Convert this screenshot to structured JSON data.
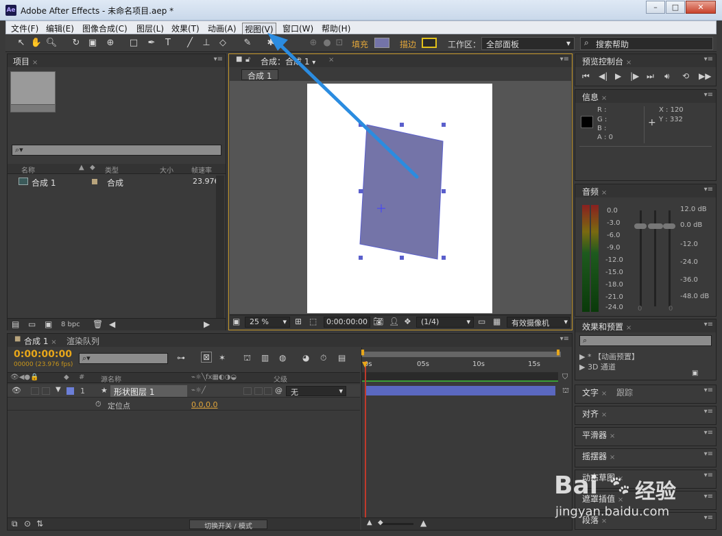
{
  "window": {
    "title": "Adobe After Effects - 未命名项目.aep *",
    "logo": "Ae",
    "min": "–",
    "max": "□",
    "close": "✕"
  },
  "menu": [
    "文件(F)",
    "编辑(E)",
    "图像合成(C)",
    "图层(L)",
    "效果(T)",
    "动画(A)",
    "视图(V)",
    "窗口(W)",
    "帮助(H)"
  ],
  "toolbar": {
    "fill_label": "填充",
    "stroke_label": "描边",
    "workspace_label": "工作区：",
    "workspace_value": "全部面板",
    "search_help": "搜索帮助",
    "fill_color": "#7474a8",
    "stroke_color": "#e3c21a"
  },
  "project": {
    "tab": "项目",
    "search_placeholder": "",
    "columns": [
      "名称",
      "类型",
      "大小",
      "帧速率"
    ],
    "rows": [
      {
        "name": "合成 1",
        "type": "合成",
        "size": "",
        "fps": "23.976"
      }
    ],
    "bpc": "8 bpc"
  },
  "composition": {
    "tab": "合成：合成 1",
    "breadcrumb": "合成 1",
    "zoom": "25 %",
    "timecode": "0:00:00:00",
    "resolution": "(1/4)",
    "camera": "有效摄像机",
    "shape_color": "#7474a8"
  },
  "preview": {
    "tab": "预览控制台"
  },
  "info": {
    "tab": "信息",
    "r": "R :",
    "g": "G :",
    "b": "B :",
    "a": "A : 0",
    "x": "X : 120",
    "y": "Y : 332"
  },
  "audio": {
    "tab": "音频",
    "left_scale": [
      "0.0",
      "-3.0",
      "-6.0",
      "-9.0",
      "-12.0",
      "-15.0",
      "-18.0",
      "-21.0",
      "-24.0"
    ],
    "right_scale": [
      "12.0 dB",
      "0.0 dB",
      "-12.0",
      "-24.0",
      "-36.0",
      "-48.0 dB"
    ],
    "slider_zero_left": "0",
    "slider_zero_right": "0"
  },
  "effects": {
    "tab": "效果和预置",
    "items": [
      "* 【动画预置】",
      "3D 通道"
    ]
  },
  "side_panels": [
    {
      "tab": "文字",
      "tab2": "跟踪"
    },
    {
      "tab": "对齐"
    },
    {
      "tab": "平滑器"
    },
    {
      "tab": "摇摆器"
    },
    {
      "tab": "动态草图"
    },
    {
      "tab": "遮罩插值"
    },
    {
      "tab": "段落"
    }
  ],
  "timeline": {
    "tab": "合成 1",
    "tab2": "渲染队列",
    "timecode": "0:00:00:00",
    "fps": "00000 (23.976 fps)",
    "col_source": "源名称",
    "col_parent": "父级",
    "col_hash": "#",
    "layer_number": "1",
    "layer_name": "形状图层 1",
    "parent_value": "无",
    "property_name": "定位点",
    "property_value": "0.0,0.0",
    "ruler": [
      "0s",
      "05s",
      "10s",
      "15s"
    ],
    "switch_mode": "切换开关 / 模式",
    "layer_color": "#6c7fd8",
    "bar_color": "#5a68c0"
  },
  "watermark": {
    "brand": "Bai",
    "brand_cn": "经验",
    "url": "jingyan.baidu.com"
  }
}
